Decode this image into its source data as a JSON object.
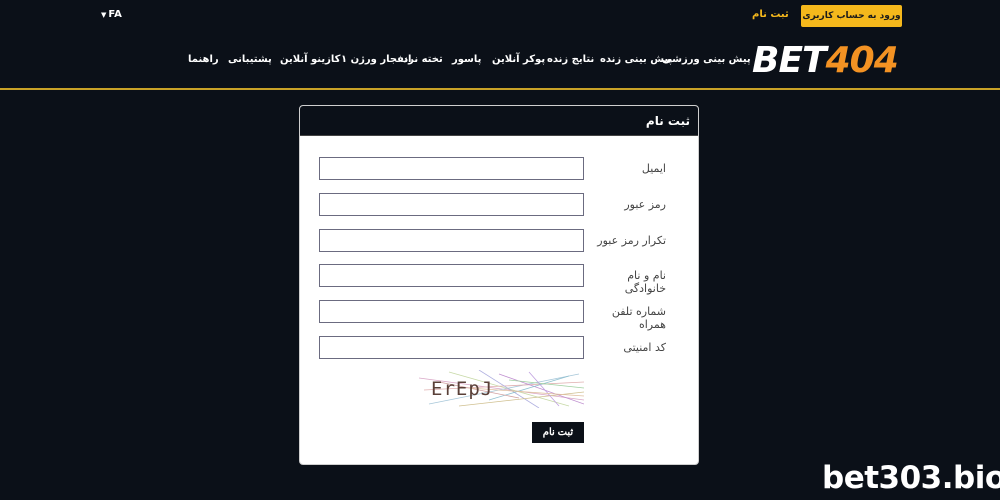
{
  "header": {
    "language": "FA",
    "login_button": "ورود به حساب کاربری",
    "register_link": "ثبت نام",
    "logo": {
      "part1": "BET",
      "part2": "404"
    },
    "nav": [
      "پیش بینی ورزشی",
      "پیش بینی زنده",
      "نتایج زنده",
      "پوکر آنلاین",
      "پاسور",
      "تخته نرد",
      "انفجار ورژن ۱",
      "کازینو آنلاین",
      "پشتیبانی",
      "راهنما"
    ]
  },
  "form": {
    "title": "ثبت نام",
    "fields": [
      {
        "label": "ایمیل",
        "value": ""
      },
      {
        "label": "رمز عبور",
        "value": ""
      },
      {
        "label": "تکرار رمز عبور",
        "value": ""
      },
      {
        "label": "نام و نام خانوادگی",
        "value": ""
      },
      {
        "label": "شماره تلفن همراه",
        "value": ""
      },
      {
        "label": "کد امنیتی",
        "value": ""
      }
    ],
    "captcha_text": "ErEpJ",
    "submit": "ثبت نام"
  },
  "watermark": "bet303.bio",
  "colors": {
    "background": "#0b1018",
    "accent": "#f5b81c",
    "logo_orange": "#f39223",
    "divider": "#c9a227"
  }
}
